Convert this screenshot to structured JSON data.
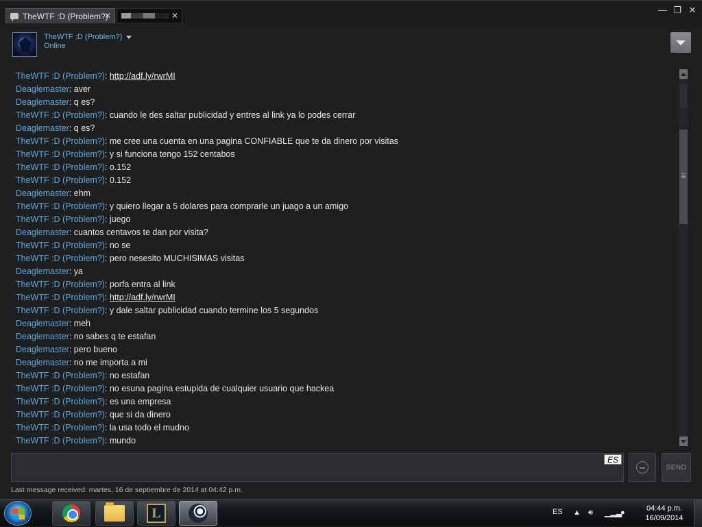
{
  "tabs": [
    {
      "label": "TheWTF :D (Problem?)",
      "active": true
    },
    {
      "label": "",
      "active": false
    }
  ],
  "header": {
    "name": "TheWTF :D (Problem?)",
    "status": "Online"
  },
  "messages": [
    {
      "sender": "TheWTF :D (Problem?)",
      "kind": "friend",
      "text": "http://adf.ly/rwrMI",
      "link": true
    },
    {
      "sender": "Deaglemaster",
      "kind": "self",
      "text": "aver"
    },
    {
      "sender": "Deaglemaster",
      "kind": "self",
      "text": "q es?"
    },
    {
      "sender": "TheWTF :D (Problem?)",
      "kind": "friend",
      "text": "cuando le des saltar publicidad y entres al link ya lo podes cerrar"
    },
    {
      "sender": "Deaglemaster",
      "kind": "self",
      "text": "q es?"
    },
    {
      "sender": "TheWTF :D (Problem?)",
      "kind": "friend",
      "text": "me cree una cuenta en una pagina CONFIABLE que te da dinero por visitas"
    },
    {
      "sender": "TheWTF :D (Problem?)",
      "kind": "friend",
      "text": "y si funciona tengo 152 centabos"
    },
    {
      "sender": "TheWTF :D (Problem?)",
      "kind": "friend",
      "text": "o.152"
    },
    {
      "sender": "TheWTF :D (Problem?)",
      "kind": "friend",
      "text": "0.152"
    },
    {
      "sender": "Deaglemaster",
      "kind": "self",
      "text": "ehm"
    },
    {
      "sender": "TheWTF :D (Problem?)",
      "kind": "friend",
      "text": "y quiero llegar a 5 dolares para comprarle un juago a un amigo"
    },
    {
      "sender": "TheWTF :D (Problem?)",
      "kind": "friend",
      "text": "juego"
    },
    {
      "sender": "Deaglemaster",
      "kind": "self",
      "text": "cuantos centavos te dan por visita?"
    },
    {
      "sender": "TheWTF :D (Problem?)",
      "kind": "friend",
      "text": "no se"
    },
    {
      "sender": "TheWTF :D (Problem?)",
      "kind": "friend",
      "text": "pero nesesito MUCHISIMAS visitas"
    },
    {
      "sender": "Deaglemaster",
      "kind": "self",
      "text": "ya"
    },
    {
      "sender": "TheWTF :D (Problem?)",
      "kind": "friend",
      "text": "porfa entra al link"
    },
    {
      "sender": "TheWTF :D (Problem?)",
      "kind": "friend",
      "text": "http://adf.ly/rwrMI",
      "link": true
    },
    {
      "sender": "TheWTF :D (Problem?)",
      "kind": "friend",
      "text": "y dale saltar publicidad cuando termine los 5 segundos"
    },
    {
      "sender": "Deaglemaster",
      "kind": "self",
      "text": "meh"
    },
    {
      "sender": "Deaglemaster",
      "kind": "self",
      "text": "no sabes q te estafan"
    },
    {
      "sender": "Deaglemaster",
      "kind": "self",
      "text": "pero bueno"
    },
    {
      "sender": "Deaglemaster",
      "kind": "self",
      "text": "no me importa a mi"
    },
    {
      "sender": "TheWTF :D (Problem?)",
      "kind": "friend",
      "text": "no estafan"
    },
    {
      "sender": "TheWTF :D (Problem?)",
      "kind": "friend",
      "text": "no esuna pagina estupida de cualquier usuario que hackea"
    },
    {
      "sender": "TheWTF :D (Problem?)",
      "kind": "friend",
      "text": "es una empresa"
    },
    {
      "sender": "TheWTF :D (Problem?)",
      "kind": "friend",
      "text": "que si da dinero"
    },
    {
      "sender": "TheWTF :D (Problem?)",
      "kind": "friend",
      "text": "la usa todo el mudno"
    },
    {
      "sender": "TheWTF :D (Problem?)",
      "kind": "friend",
      "text": "mundo"
    }
  ],
  "input": {
    "value": "",
    "lang_indicator": "ES",
    "send_label": "SEND"
  },
  "status_line": "Last message received: martes, 16 de septiembre de 2014 at 04:42 p.m.",
  "taskbar": {
    "apps": [
      "chrome-icon",
      "explorer-folder-icon",
      "league-of-legends-icon",
      "steam-icon"
    ],
    "active_app": "steam-icon",
    "tray_lang": "ES",
    "time": "04:44 p.m.",
    "date": "16/09/2014"
  },
  "colors": {
    "friend_name": "#62a8dd",
    "self_name": "#62a8dd",
    "message_text": "#e6e6e6",
    "background": "#1e1f21"
  }
}
